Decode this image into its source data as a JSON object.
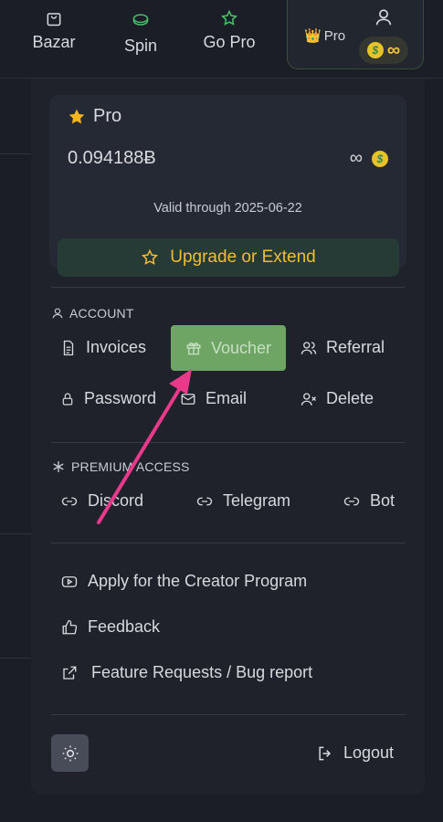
{
  "nav": {
    "bazar": "Bazar",
    "spin": "Spin",
    "go_pro": "Go Pro",
    "pro_badge": "Pro",
    "infinity": "∞"
  },
  "pro_card": {
    "title": "Pro",
    "balance": "0.094188Ƀ",
    "infinity": "∞",
    "valid_label": "Valid through",
    "valid_date": "2025-06-22",
    "upgrade_label": "Upgrade or Extend"
  },
  "account": {
    "header": "ACCOUNT",
    "invoices": "Invoices",
    "voucher": "Voucher",
    "referral": "Referral",
    "password": "Password",
    "email": "Email",
    "delete": "Delete"
  },
  "premium": {
    "header": "PREMIUM ACCESS",
    "discord": "Discord",
    "telegram": "Telegram",
    "bot": "Bot"
  },
  "links": {
    "creator": "Apply for the Creator Program",
    "feedback": "Feedback",
    "feature": "Feature Requests / Bug report"
  },
  "footer": {
    "logout": "Logout"
  },
  "colors": {
    "accent_gold": "#f0be2f",
    "voucher_green": "#6ea565",
    "annotation_arrow": "#e8398a"
  },
  "icons": [
    "bag-icon",
    "spin-icon",
    "star-icon",
    "crown-icon",
    "user-icon",
    "coin-icon",
    "file-icon",
    "gift-icon",
    "users-icon",
    "lock-icon",
    "mail-icon",
    "user-x-icon",
    "asterisk-icon",
    "link-icon",
    "youtube-icon",
    "thumbs-up-icon",
    "external-link-icon",
    "sun-icon",
    "logout-icon"
  ]
}
